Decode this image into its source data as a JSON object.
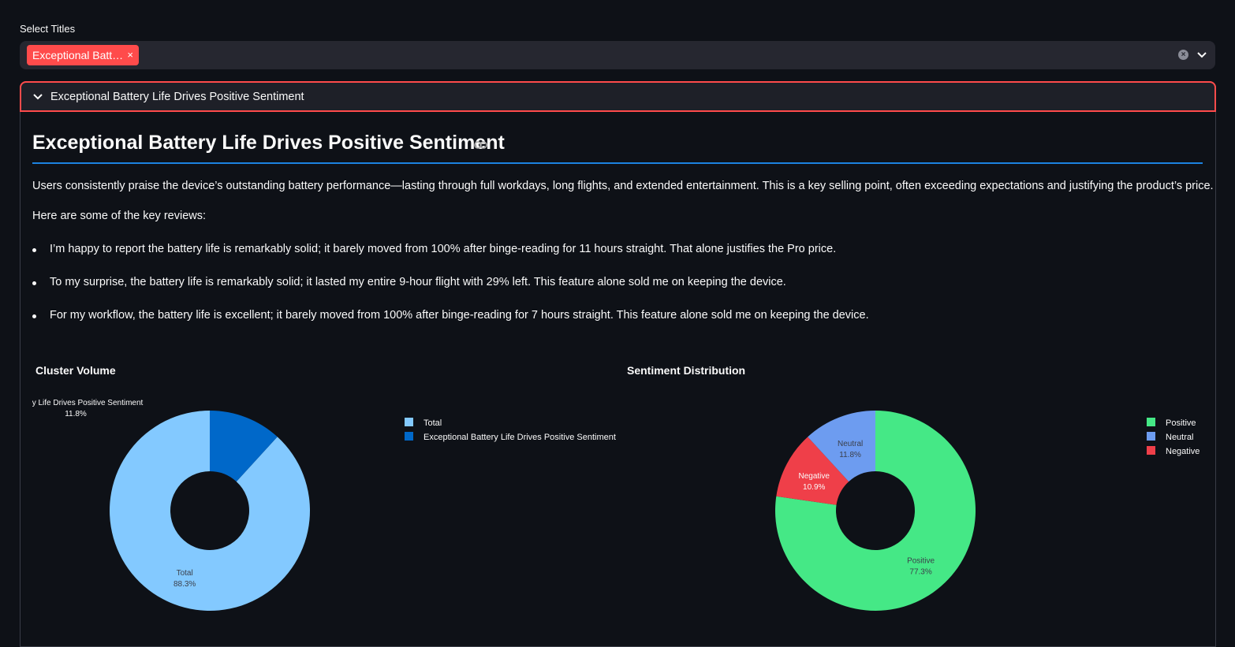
{
  "select": {
    "label": "Select Titles",
    "chip_label": "Exceptional Batt…",
    "chip_remove": "×"
  },
  "expander": {
    "title": "Exceptional Battery Life Drives Positive Sentiment"
  },
  "content": {
    "heading": "Exceptional Battery Life Drives Positive Sentiment",
    "summary": "Users consistently praise the device’s outstanding battery performance—lasting through full workdays, long flights, and extended entertainment. This is a key selling point, often exceeding expectations and justifying the product’s price.",
    "reviews_intro": "Here are some of the key reviews:",
    "reviews": [
      "I’m happy to report the battery life is remarkably solid; it barely moved from 100% after binge-reading for 11 hours straight. That alone justifies the Pro price.",
      "To my surprise, the battery life is remarkably solid; it lasted my entire 9-hour flight with 29% left. This feature alone sold me on keeping the device.",
      "For my workflow, the battery life is excellent; it barely moved from 100% after binge-reading for 7 hours straight. This feature alone sold me on keeping the device."
    ]
  },
  "colors": {
    "accent": "#ff4b4b",
    "rule": "#1c83e1",
    "total": "#83c9ff",
    "cluster": "#0068c9",
    "positive": "#45e886",
    "neutral": "#6d9cf0",
    "negative": "#ef3f49"
  },
  "chart_data": [
    {
      "type": "pie",
      "title": "Cluster Volume",
      "categories": [
        "Total",
        "Exceptional Battery Life Drives Positive Sentiment"
      ],
      "values": [
        88.3,
        11.8
      ],
      "slice_labels": [
        "Total",
        "…attery Life Drives Positive Sentiment"
      ],
      "value_labels": [
        "88.3%",
        "11.8%"
      ],
      "legend": [
        "Total",
        "Exceptional Battery Life Drives Positive Sentiment"
      ],
      "legend_placement": "top-right"
    },
    {
      "type": "pie",
      "title": "Sentiment Distribution",
      "categories": [
        "Positive",
        "Neutral",
        "Negative"
      ],
      "values": [
        77.3,
        11.8,
        10.9
      ],
      "value_labels": [
        "77.3%",
        "11.8%",
        "10.9%"
      ],
      "legend": [
        "Positive",
        "Neutral",
        "Negative"
      ],
      "legend_placement": "top-right"
    }
  ]
}
